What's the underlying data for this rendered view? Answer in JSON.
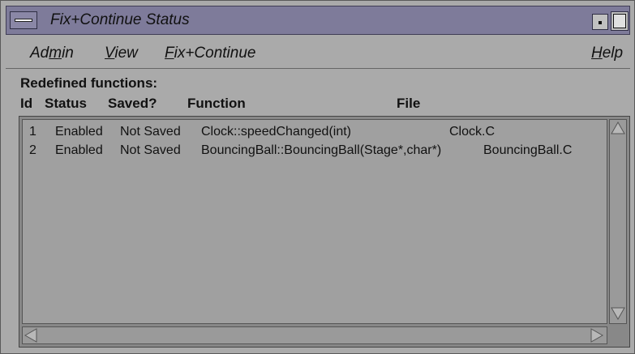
{
  "window": {
    "title": "Fix+Continue Status"
  },
  "menubar": {
    "items": [
      {
        "pre": "Ad",
        "mn": "m",
        "post": "in"
      },
      {
        "pre": "",
        "mn": "V",
        "post": "iew"
      },
      {
        "pre": "",
        "mn": "F",
        "post": "ix+Continue"
      },
      {
        "pre": "",
        "mn": "H",
        "post": "elp"
      }
    ]
  },
  "list": {
    "section_label": "Redefined functions:",
    "headers": [
      "Id",
      "Status",
      "Saved?",
      "Function",
      "File"
    ],
    "rows": [
      {
        "id": "1",
        "status": "Enabled",
        "saved": "Not Saved",
        "function": "Clock::speedChanged(int)",
        "file": "Clock.C"
      },
      {
        "id": "2",
        "status": "Enabled",
        "saved": "Not Saved",
        "function": "BouncingBall::BouncingBall(Stage*,char*)",
        "file": "BouncingBall.C"
      }
    ]
  },
  "icons": {
    "window_menu": "window-menu-icon",
    "minimize": "minimize-icon",
    "maximize": "maximize-icon",
    "scroll_up": "arrow-up-icon",
    "scroll_down": "arrow-down-icon",
    "scroll_left": "arrow-left-icon",
    "scroll_right": "arrow-right-icon"
  },
  "colors": {
    "titlebar": "#7e7b9a",
    "background": "#aaaaaa",
    "list": "#a0a0a0"
  }
}
